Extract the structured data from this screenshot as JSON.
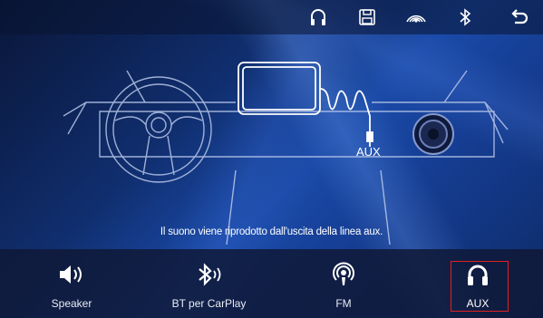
{
  "topbar": {
    "icons": [
      "headphones-icon",
      "save-icon",
      "radio-signal-icon",
      "bluetooth-icon",
      "back-icon"
    ]
  },
  "illustration": {
    "aux_label": "AUX"
  },
  "message": "Il suono viene riprodotto dall'uscita della linea aux.",
  "tabs": [
    {
      "label": "Speaker",
      "icon": "speaker-icon"
    },
    {
      "label": "BT per CarPlay",
      "icon": "bluetooth-audio-icon"
    },
    {
      "label": "FM",
      "icon": "podcast-icon"
    },
    {
      "label": "AUX",
      "icon": "headphones-icon",
      "active": true
    }
  ],
  "colors": {
    "highlight": "#e02020",
    "line": "#ffffff"
  }
}
